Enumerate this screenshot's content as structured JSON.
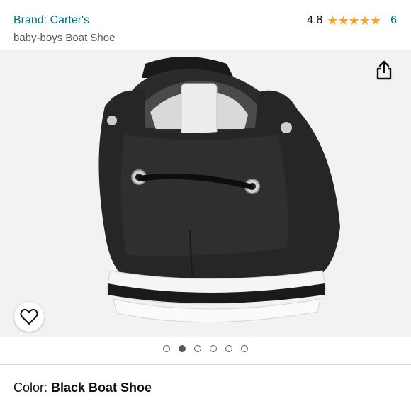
{
  "header": {
    "brand": "Brand: Carter's",
    "subtitle": "baby-boys Boat Shoe",
    "rating_value": "4.8",
    "rating_stars": 5,
    "review_count": "6"
  },
  "icons": {
    "share": "share-icon",
    "favorite": "heart-icon",
    "star": "star-icon"
  },
  "carousel": {
    "total": 6,
    "active_index": 1
  },
  "variant": {
    "label": "Color: ",
    "value": "Black Boat Shoe"
  },
  "colors": {
    "link": "#007185",
    "star": "#ffa41c",
    "text": "#0f1111",
    "muted": "#565959",
    "image_bg": "#f2f2f2"
  }
}
